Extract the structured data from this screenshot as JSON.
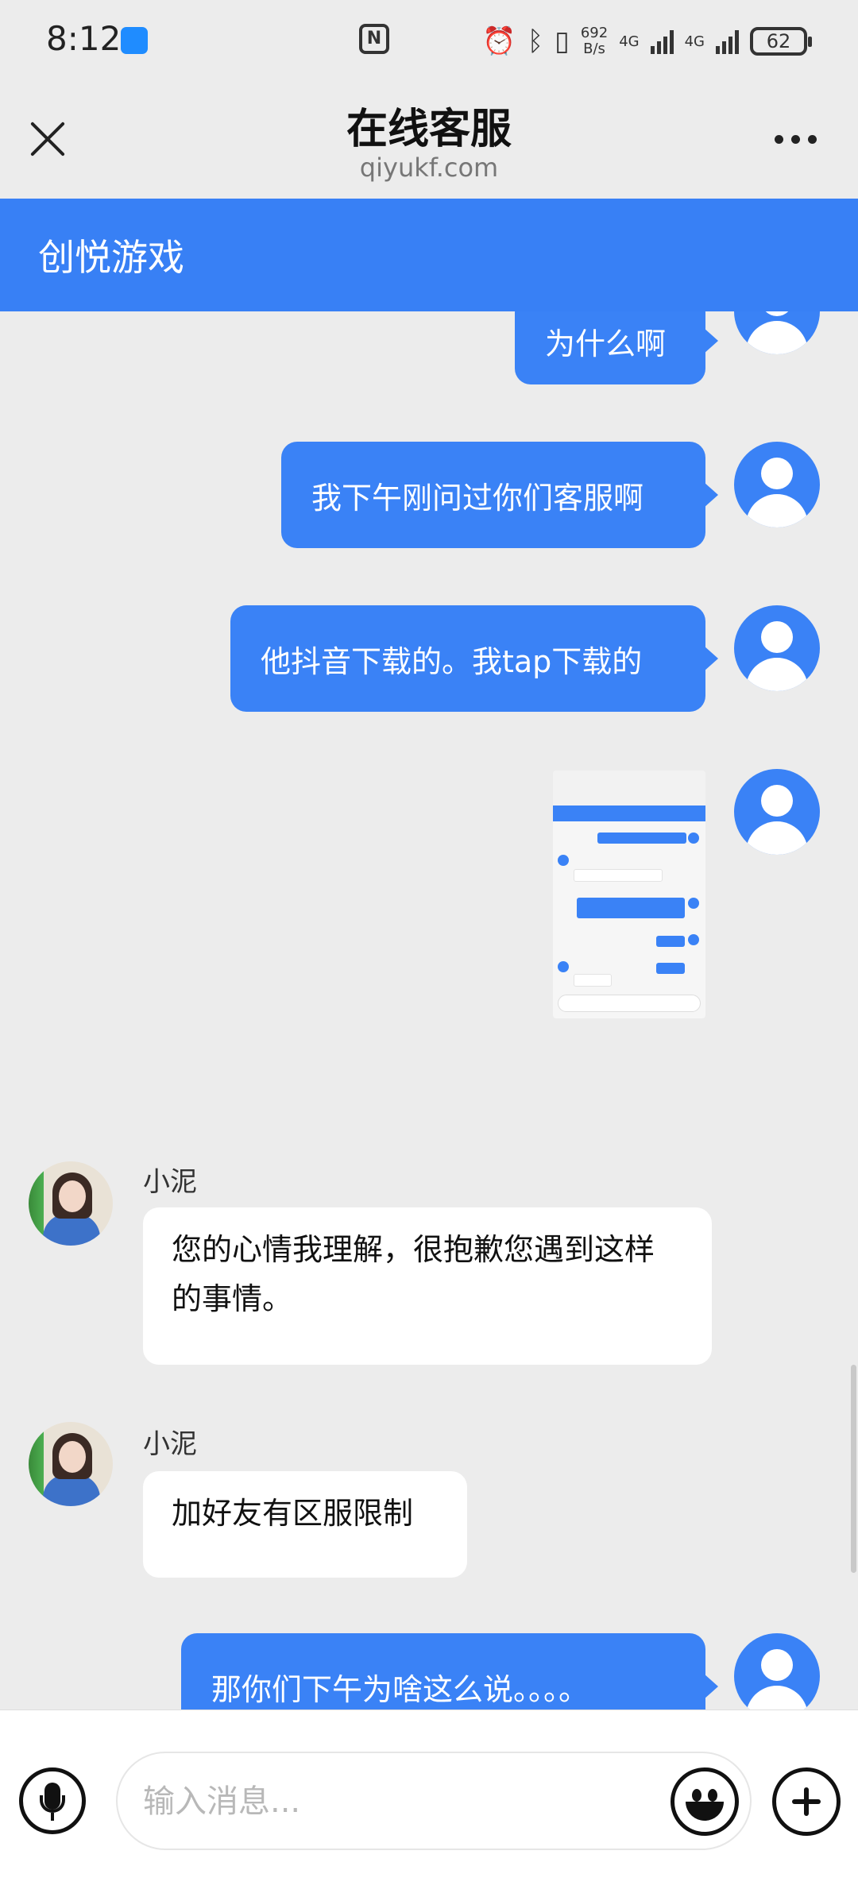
{
  "status_bar": {
    "time": "8:12",
    "net_speed_value": "692",
    "net_speed_unit": "B/s",
    "network_1": "4G",
    "network_2": "4G",
    "battery": "62",
    "icons": [
      "app-notification-icon",
      "nfc-icon",
      "alarm-icon",
      "bluetooth-icon",
      "vibrate-icon",
      "signal-icon",
      "battery-icon"
    ]
  },
  "browser": {
    "title": "在线客服",
    "domain": "qiyukf.com",
    "close_icon": "close-icon",
    "more_icon": "more-icon"
  },
  "chat": {
    "header_title": "创悦游戏",
    "messages": [
      {
        "from": "user",
        "type": "text",
        "text": "为什么啊"
      },
      {
        "from": "user",
        "type": "text",
        "text": "我下午刚问过你们客服啊"
      },
      {
        "from": "user",
        "type": "text",
        "text": "他抖音下载的。我tap下载的"
      },
      {
        "from": "user",
        "type": "image",
        "alt": "screenshot"
      },
      {
        "from": "agent",
        "name": "小泥",
        "type": "text",
        "text": "您的心情我理解，很抱歉您遇到这样的事情。"
      },
      {
        "from": "agent",
        "name": "小泥",
        "type": "text",
        "text": "加好友有区服限制"
      },
      {
        "from": "user",
        "type": "text",
        "text": "那你们下午为啥这么说。。。。"
      }
    ]
  },
  "input_bar": {
    "placeholder": "输入消息...",
    "value": "",
    "voice_icon": "microphone-icon",
    "emoji_icon": "emoji-icon",
    "plus_icon": "plus-icon"
  },
  "colors": {
    "brand_blue": "#3880f5",
    "user_bubble": "#3a82f6",
    "agent_bubble": "#ffffff",
    "background": "#ececec"
  }
}
